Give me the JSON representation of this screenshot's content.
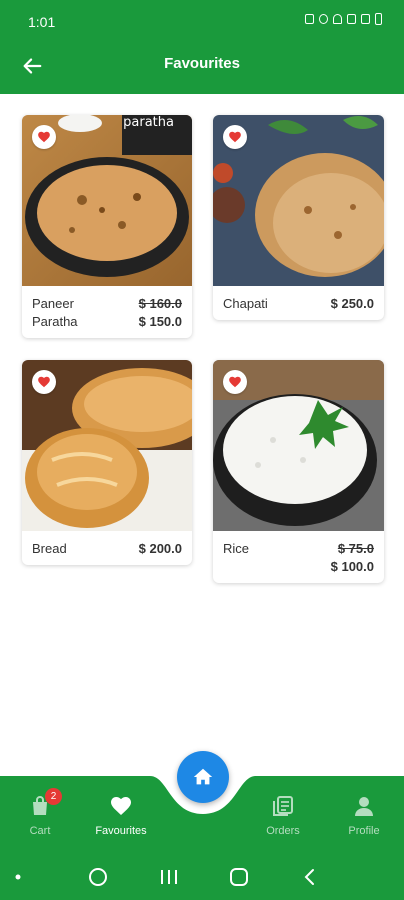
{
  "status_bar": {
    "time": "1:01"
  },
  "header": {
    "title": "Favourites"
  },
  "products": [
    {
      "name": "Paneer Paratha",
      "old_price": "$ 160.0",
      "price": "$ 150.0",
      "image_text": "paratha"
    },
    {
      "name": "Chapati",
      "old_price": "",
      "price": "$ 250.0"
    },
    {
      "name": "Bread",
      "old_price": "",
      "price": "$ 200.0"
    },
    {
      "name": "Rice",
      "old_price": "$ 75.0",
      "price": "$ 100.0"
    }
  ],
  "bottom_nav": {
    "cart": {
      "label": "Cart",
      "badge": "2"
    },
    "favourites": {
      "label": "Favourites"
    },
    "orders": {
      "label": "Orders"
    },
    "profile": {
      "label": "Profile"
    }
  },
  "colors": {
    "primary": "#1a9a3c",
    "fab": "#1e88e5",
    "badge": "#e53935"
  }
}
